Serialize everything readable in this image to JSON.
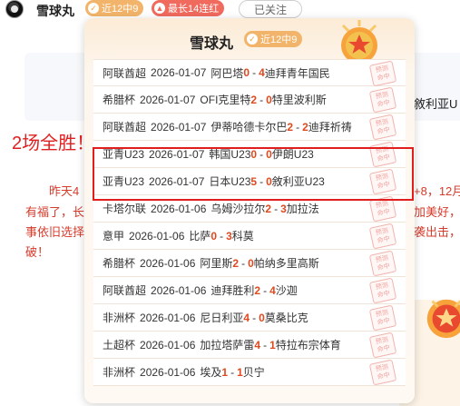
{
  "header": {
    "name": "雪球丸",
    "badge_recent": "近12中9",
    "badge_streak": "最长14连红",
    "follow_label": "已关注"
  },
  "background": {
    "title": "2场全胜！",
    "line1_left": "昨天4",
    "line1_right": "+8，12月",
    "line2_left": "有福了，长",
    "line2_right": "加美好，",
    "line3_left": "事依旧选择",
    "line3_right": "袭出击，争",
    "line4_left": "破！",
    "right_text": "敘利亚U"
  },
  "popup": {
    "name": "雪球丸",
    "badge": "近12中9",
    "stamp_label": "预测命中",
    "rows": [
      {
        "league": "阿联酋超",
        "date": "2026-01-07",
        "home": "阿巴塔",
        "hs": "0",
        "as": "4",
        "away": "迪拜青年国民"
      },
      {
        "league": "希腊杯",
        "date": "2026-01-07",
        "home": "OFI克里特",
        "hs": "2",
        "as": "0",
        "away": "特里波利斯"
      },
      {
        "league": "阿联酋超",
        "date": "2026-01-07",
        "home": "伊蒂哈德卡尔巴",
        "hs": "2",
        "as": "2",
        "away": "迪拜祈祷"
      },
      {
        "league": "亚青U23",
        "date": "2026-01-07",
        "home": "韩国U23",
        "hs": "0",
        "as": "0",
        "away": "伊朗U23"
      },
      {
        "league": "亚青U23",
        "date": "2026-01-07",
        "home": "日本U23",
        "hs": "5",
        "as": "0",
        "away": "敘利亚U23"
      },
      {
        "league": "卡塔尔联",
        "date": "2026-01-06",
        "home": "乌姆沙拉尔",
        "hs": "2",
        "as": "3",
        "away": "加拉法"
      },
      {
        "league": "意甲",
        "date": "2026-01-06",
        "home": "比萨",
        "hs": "0",
        "as": "3",
        "away": "科莫"
      },
      {
        "league": "希腊杯",
        "date": "2026-01-06",
        "home": "阿里斯",
        "hs": "2",
        "as": "0",
        "away": "帕纳多里高斯"
      },
      {
        "league": "阿联酋超",
        "date": "2026-01-06",
        "home": "迪拜胜利",
        "hs": "2",
        "as": "4",
        "away": "沙迦"
      },
      {
        "league": "非洲杯",
        "date": "2026-01-06",
        "home": "尼日利亚",
        "hs": "4",
        "as": "0",
        "away": "莫桑比克"
      },
      {
        "league": "土超杯",
        "date": "2026-01-06",
        "home": "加拉塔萨雷",
        "hs": "4",
        "as": "1",
        "away": "特拉布宗体育"
      },
      {
        "league": "非洲杯",
        "date": "2026-01-06",
        "home": "埃及",
        "hs": "1",
        "as": "1",
        "away": "贝宁"
      }
    ]
  },
  "colors": {
    "score": "#e0491f",
    "highlight_border": "#e11d1d",
    "badge_orange": "#f2b46a",
    "badge_red": "#f06a5e"
  },
  "icons": [
    "avatar-icon",
    "trophy-icon",
    "fire-icon",
    "stamp-icon"
  ]
}
